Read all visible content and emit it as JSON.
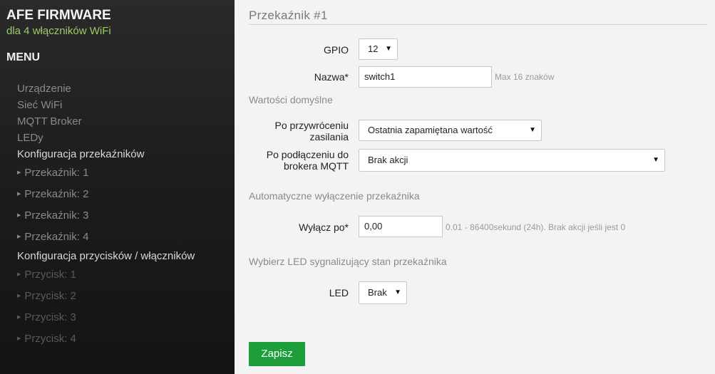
{
  "sidebar": {
    "brand_title": "AFE FIRMWARE",
    "brand_subtitle": "dla 4 włączników WiFi",
    "menu_heading": "MENU",
    "items": [
      {
        "label": "Urządzenie"
      },
      {
        "label": "Sieć WiFi"
      },
      {
        "label": "MQTT Broker"
      },
      {
        "label": "LEDy"
      },
      {
        "label": "Konfiguracja przekaźników"
      },
      {
        "label": "Przekaźnik: 1"
      },
      {
        "label": "Przekaźnik: 2"
      },
      {
        "label": "Przekaźnik: 3"
      },
      {
        "label": "Przekaźnik: 4"
      },
      {
        "label": "Konfiguracja przycisków / włączników"
      },
      {
        "label": "Przycisk: 1"
      },
      {
        "label": "Przycisk: 2"
      },
      {
        "label": "Przycisk: 3"
      },
      {
        "label": "Przycisk: 4"
      }
    ]
  },
  "main": {
    "title": "Przekaźnik #1",
    "gpio": {
      "label": "GPIO",
      "value": "12"
    },
    "name": {
      "label": "Nazwa*",
      "value": "switch1",
      "hint": "Max 16 znaków"
    },
    "defaults_section": "Wartości domyślne",
    "power_restore": {
      "label_line1": "Po przywróceniu",
      "label_line2": "zasilania",
      "value": "Ostatnia zapamiętana wartość"
    },
    "mqtt_connect": {
      "label_line1": "Po podłączeniu do",
      "label_line2": "brokera MQTT",
      "value": "Brak akcji"
    },
    "auto_off_section": "Automatyczne wyłączenie przekaźnika",
    "turn_off": {
      "label": "Wyłącz po*",
      "value": "0,00",
      "hint": "0.01 - 86400sekund (24h). Brak akcji jeśli jest 0"
    },
    "led_section": "Wybierz LED sygnalizujący stan przekaźnika",
    "led": {
      "label": "LED",
      "value": "Brak"
    },
    "save_label": "Zapisz"
  }
}
